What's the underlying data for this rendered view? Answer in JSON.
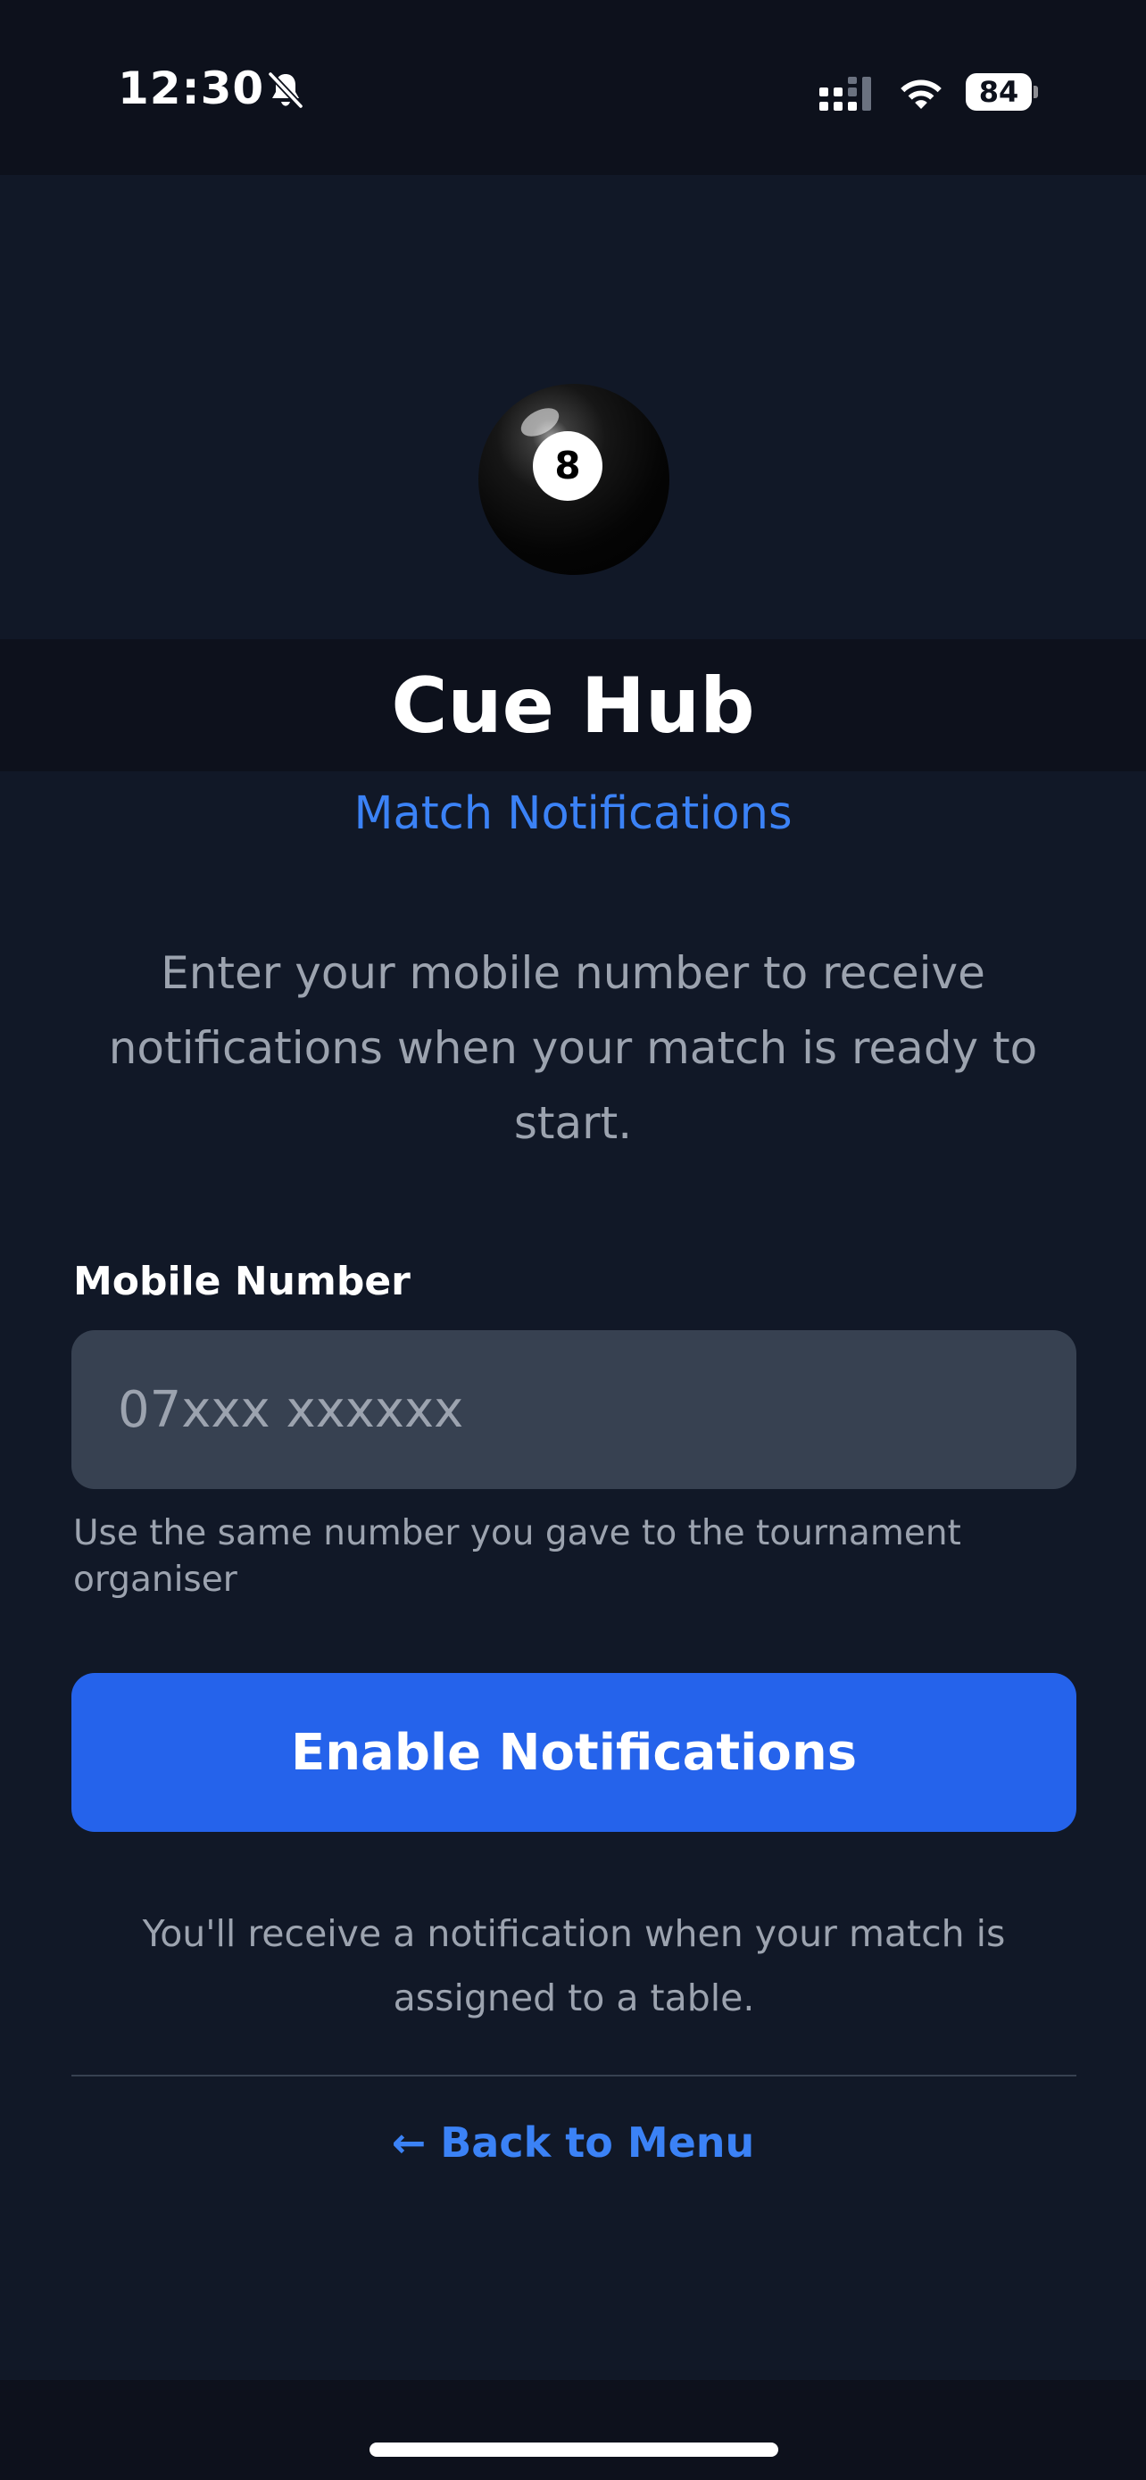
{
  "status_bar": {
    "time": "12:30",
    "battery": "84",
    "icons": [
      "bell-slash-icon",
      "signal-icon",
      "wifi-icon",
      "battery-icon"
    ]
  },
  "logo": {
    "icon": "eight-ball-icon",
    "number": "8"
  },
  "header": {
    "title": "Cue Hub",
    "subtitle": "Match Notifications"
  },
  "intro": "Enter your mobile number to receive notifications when your match is ready to start.",
  "form": {
    "label": "Mobile Number",
    "placeholder": "07xxx xxxxxx",
    "value": "",
    "hint": "Use the same number you gave to the tournament organiser",
    "submit_label": "Enable Notifications"
  },
  "info": "You'll receive a notification when your match is assigned to a table.",
  "back_link": "← Back to Menu",
  "colors": {
    "background": "#111827",
    "accent": "#3b82f6",
    "button": "#2563eb",
    "input": "#374151"
  }
}
